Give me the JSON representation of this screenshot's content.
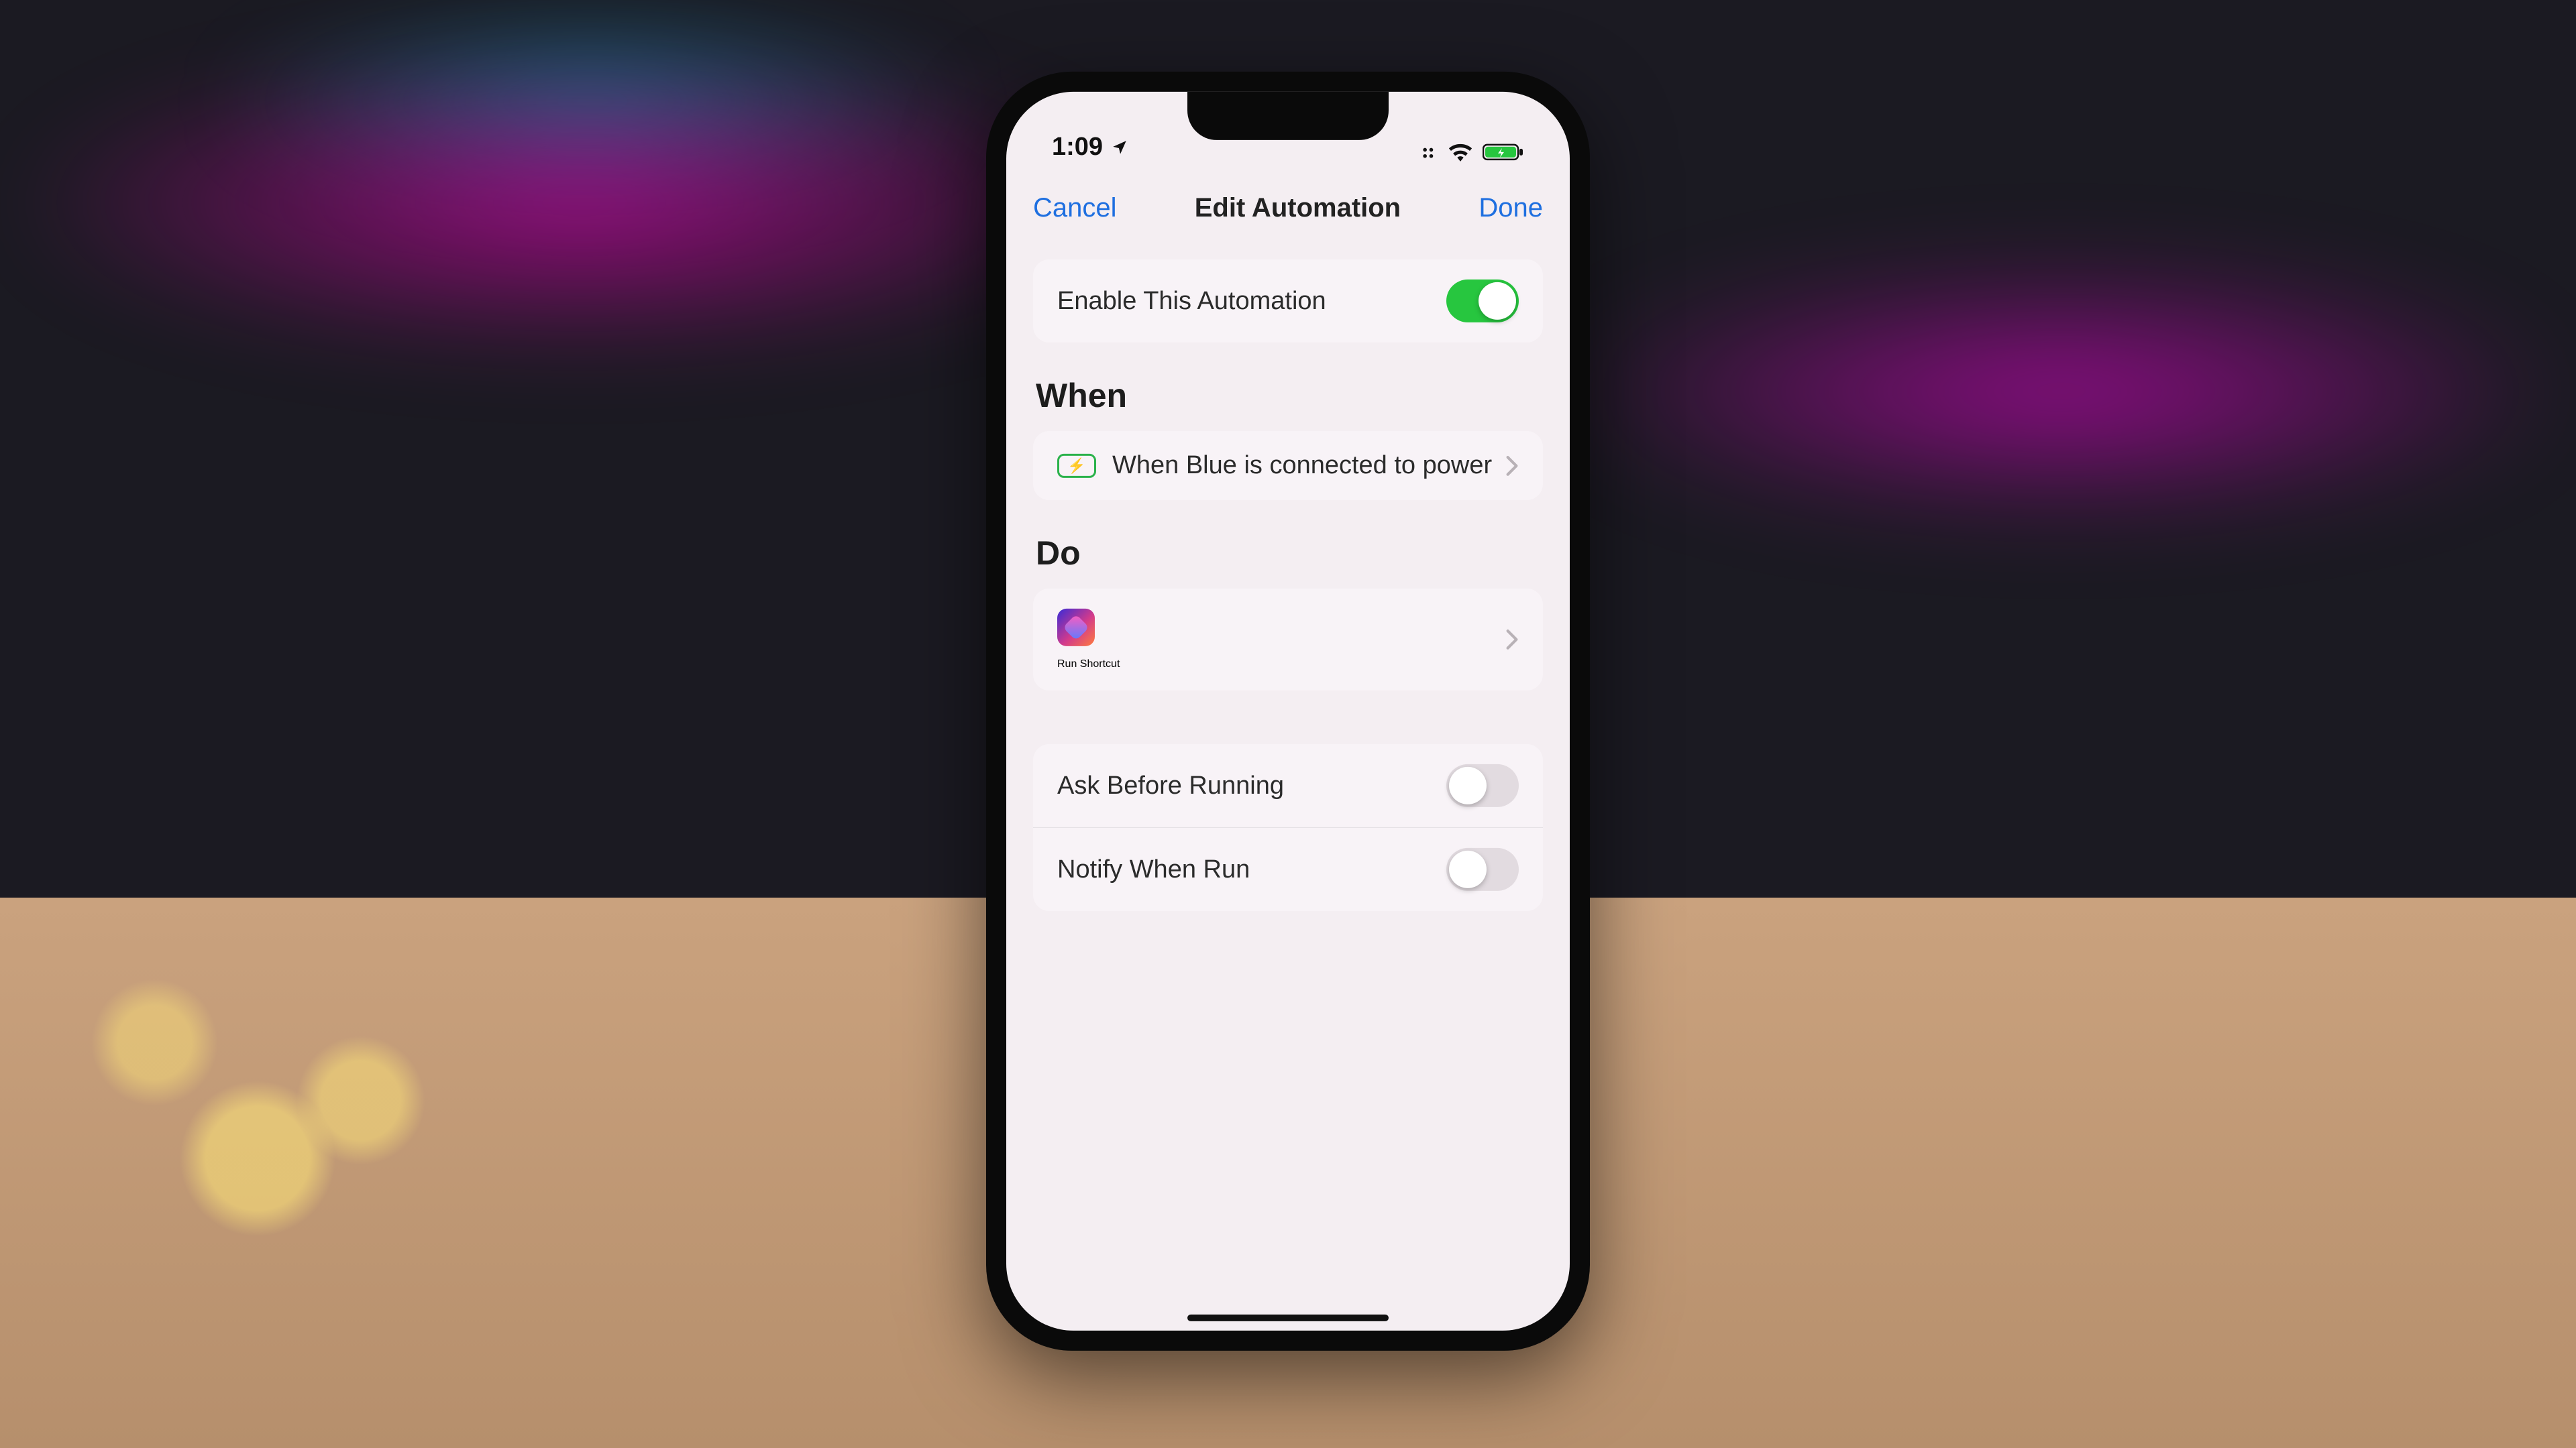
{
  "status": {
    "time": "1:09"
  },
  "nav": {
    "left": "Cancel",
    "title": "Edit Automation",
    "right": "Done"
  },
  "enable": {
    "label": "Enable This Automation",
    "on": true
  },
  "when": {
    "heading": "When",
    "row": {
      "label": "When Blue is connected to power"
    }
  },
  "do": {
    "heading": "Do",
    "row": {
      "label": "Run Shortcut"
    }
  },
  "options": {
    "ask": {
      "label": "Ask Before Running",
      "on": false
    },
    "notify": {
      "label": "Notify When Run",
      "on": false
    }
  }
}
